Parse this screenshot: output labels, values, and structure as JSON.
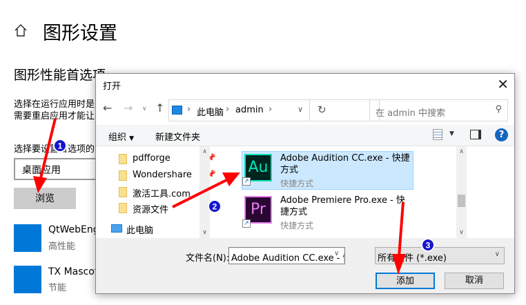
{
  "settings": {
    "title": "图形设置",
    "section_title": "图形性能首选项",
    "desc_line1": "选择在运行应用时是",
    "desc_line2": "需要重启应用才能让",
    "choose_label": "选择要设置首选项的",
    "app_type_select": "桌面应用",
    "browse_button": "浏览",
    "apps": [
      {
        "name": "QtWebEngi",
        "pref": "高性能"
      },
      {
        "name": "TX Mascot.",
        "pref": "节能"
      }
    ]
  },
  "dialog": {
    "title": "打开",
    "breadcrumb": [
      "此电脑",
      "admin"
    ],
    "search_placeholder": "在 admin 中搜索",
    "organize": "组织",
    "new_folder": "新建文件夹",
    "nav_items": [
      {
        "label": "pdfforge",
        "pinned": true
      },
      {
        "label": "Wondershare",
        "pinned": true
      },
      {
        "label": "激活工具.com",
        "pinned": false
      },
      {
        "label": "资源文件",
        "pinned": false
      }
    ],
    "this_pc": "此电脑",
    "files": [
      {
        "name": "Adobe Audition CC.exe - 快捷方式",
        "type": "快捷方式",
        "icon_text": "Au",
        "selected": true
      },
      {
        "name": "Adobe Premiere Pro.exe - 快捷方式",
        "type": "快捷方式",
        "icon_text": "Pr",
        "selected": false
      }
    ],
    "filename_label": "文件名(N):",
    "filename_value": "Adobe Audition CC.exe - 快捷方",
    "filter_value": "所有文件 (*.exe)",
    "add_button": "添加",
    "cancel_button": "取消"
  },
  "annotations": [
    "1",
    "2",
    "3"
  ],
  "colors": {
    "accent": "#0078d7",
    "selection": "#cce8ff",
    "arrow": "#ff0000"
  }
}
